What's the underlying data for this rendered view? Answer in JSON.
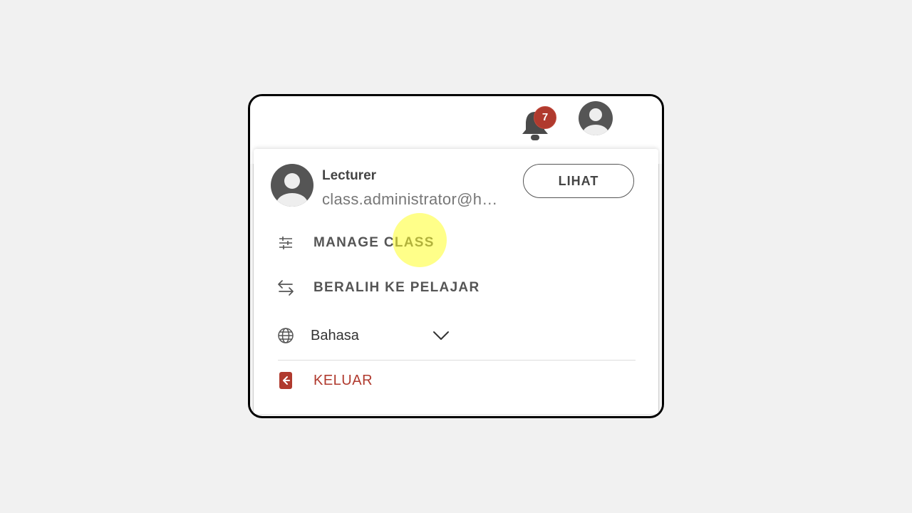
{
  "topbar": {
    "notification_count": "7",
    "bell_icon": "bell-icon",
    "avatar_icon": "user-avatar-icon"
  },
  "profile": {
    "role": "Lecturer",
    "email": "class.administrator@h…",
    "view_button": "LIHAT"
  },
  "menu": {
    "manage_class": "MANAGE CLASS",
    "switch_role": "BERALIH KE PELAJAR",
    "language_label": "Bahasa",
    "logout": "KELUAR"
  },
  "colors": {
    "accent_red": "#b03a2e",
    "text_dark": "#444444",
    "text_muted": "#777777",
    "highlight": "#ffff28"
  }
}
